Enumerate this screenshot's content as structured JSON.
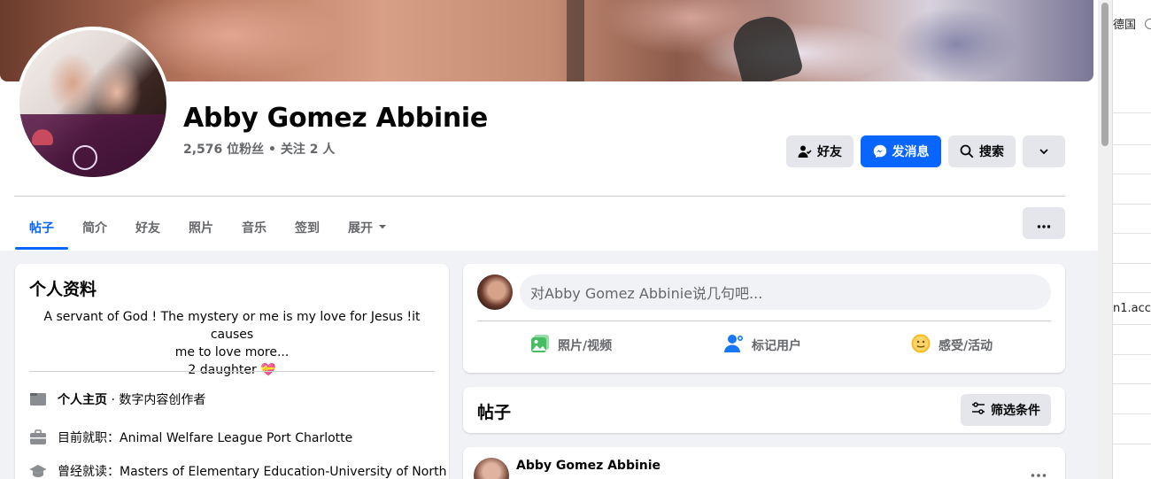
{
  "profile": {
    "name": "Abby Gomez Abbinie",
    "stats": "2,576 位粉丝 • 关注 2 人"
  },
  "actions": {
    "friends_label": "好友",
    "message_label": "发消息",
    "search_label": "搜索"
  },
  "tabs": [
    {
      "label": "帖子",
      "active": true
    },
    {
      "label": "简介"
    },
    {
      "label": "好友"
    },
    {
      "label": "照片"
    },
    {
      "label": "音乐"
    },
    {
      "label": "签到"
    },
    {
      "label": "展开"
    }
  ],
  "intro": {
    "title": "个人资料",
    "bio_line1": "A servant of God ! The mystery or me is my love for Jesus !it causes",
    "bio_line2": "me to love more...",
    "bio_line3": "2 daughter 💝",
    "page_label": "个人主页",
    "page_category": " · 数字内容创作者",
    "work_prefix": "目前就职：",
    "work_value": "Animal Welfare League Port Charlotte",
    "edu_prefix": "曾经就读：",
    "edu_value": "Masters of Elementary Education-University of North"
  },
  "composer": {
    "placeholder": "对Abby Gomez Abbinie说几句吧...",
    "photo_video": "照片/视频",
    "tag_people": "标记用户",
    "feeling_activity": "感受/活动"
  },
  "posts": {
    "title": "帖子",
    "filter_label": "筛选条件",
    "first_post_author": "Abby Gomez Abbinie"
  },
  "side_panel": {
    "text1": "德国",
    "text2": "n1.acco"
  },
  "colors": {
    "accent": "#0866ff",
    "secondary_text": "#65676b",
    "button_bg": "#e4e6eb"
  }
}
